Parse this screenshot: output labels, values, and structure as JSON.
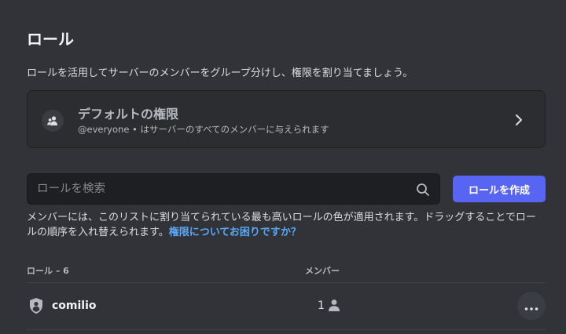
{
  "page": {
    "title": "ロール",
    "subtitle": "ロールを活用してサーバーのメンバーをグループ分けし、権限を割り当てましょう。"
  },
  "default_permissions": {
    "title": "デフォルトの権限",
    "description": "@everyone • はサーバーのすべてのメンバーに与えられます",
    "icon": "people-icon",
    "chevron": "chevron-right-icon"
  },
  "search": {
    "placeholder": "ロールを検索",
    "value": "",
    "icon": "search-icon"
  },
  "create_button": {
    "label": "ロールを作成",
    "color": "#5865f2"
  },
  "info": {
    "text": "メンバーには、このリストに割り当てられている最も高いロールの色が適用されます。ドラッグすることでロールの順序を入れ替えられます。",
    "link": "権限についてお困りですか？",
    "link_color": "#5aa7f6"
  },
  "table": {
    "headers": {
      "roles": "ロール – 6",
      "members": "メンバー"
    },
    "rows": [
      {
        "name": "comilio",
        "member_count": "1",
        "role_icon": "shield-icon",
        "member_icon": "person-icon",
        "more_icon": "more-horizontal-icon"
      }
    ]
  }
}
